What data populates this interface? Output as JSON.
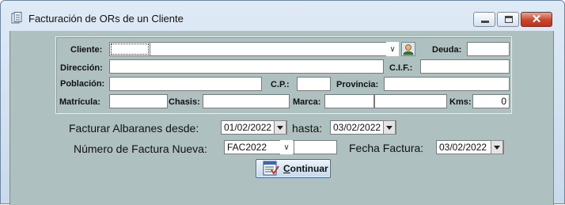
{
  "window": {
    "title": "Facturación de ORs de un Cliente",
    "icon": "document-icon",
    "controls": [
      "minimize",
      "maximize",
      "close"
    ]
  },
  "client_group": {
    "cliente": {
      "label": "Cliente:",
      "code": "",
      "name": ""
    },
    "deuda": {
      "label": "Deuda:",
      "value": ""
    },
    "direccion": {
      "label": "Dirección:",
      "value": ""
    },
    "cif": {
      "label": "C.I.F.:",
      "value": ""
    },
    "poblacion": {
      "label": "Población:",
      "value": ""
    },
    "cp": {
      "label": "C.P.:",
      "value": ""
    },
    "provincia": {
      "label": "Provincia:",
      "value": ""
    },
    "matricula": {
      "label": "Matrícula:",
      "value": ""
    },
    "chasis": {
      "label": "Chasis:",
      "value": ""
    },
    "marca": {
      "label": "Marca:",
      "value": "",
      "model": ""
    },
    "kms": {
      "label": "Kms:",
      "value": "0"
    }
  },
  "billing": {
    "desde_label": "Facturar Albaranes desde:",
    "desde_value": "01/02/2022",
    "hasta_label": "hasta:",
    "hasta_value": "03/02/2022",
    "numero_label": "Número de Factura Nueva:",
    "serie_value": "FAC2022",
    "numero_value": "",
    "fecha_label": "Fecha Factura:",
    "fecha_value": "03/02/2022"
  },
  "actions": {
    "continuar_label": "Continuar",
    "continuar_icon": "invoice-icon"
  }
}
